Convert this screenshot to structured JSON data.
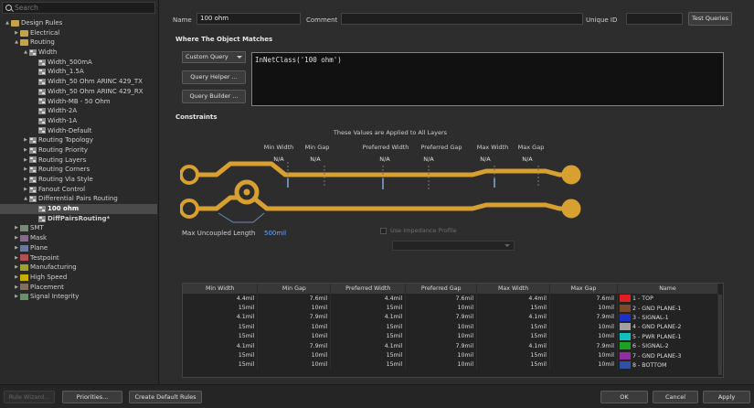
{
  "search": {
    "placeholder": "Search"
  },
  "tree": [
    {
      "label": "Design Rules",
      "indent": 0,
      "tw": "▲",
      "icon": "folder"
    },
    {
      "label": "Electrical",
      "indent": 1,
      "tw": "▶",
      "icon": "folder"
    },
    {
      "label": "Routing",
      "indent": 1,
      "tw": "▲",
      "icon": "folder"
    },
    {
      "label": "Width",
      "indent": 2,
      "tw": "▲",
      "icon": "rule"
    },
    {
      "label": "Width_500mA",
      "indent": 3,
      "tw": "",
      "icon": "rule"
    },
    {
      "label": "Width_1.5A",
      "indent": 3,
      "tw": "",
      "icon": "rule"
    },
    {
      "label": "Width_50 Ohm ARINC 429_TX",
      "indent": 3,
      "tw": "",
      "icon": "rule"
    },
    {
      "label": "Width_50 Ohm ARINC 429_RX",
      "indent": 3,
      "tw": "",
      "icon": "rule"
    },
    {
      "label": "Width-MB - 50 Ohm",
      "indent": 3,
      "tw": "",
      "icon": "rule"
    },
    {
      "label": "Width-2A",
      "indent": 3,
      "tw": "",
      "icon": "rule"
    },
    {
      "label": "Width-1A",
      "indent": 3,
      "tw": "",
      "icon": "rule"
    },
    {
      "label": "Width-Default",
      "indent": 3,
      "tw": "",
      "icon": "rule"
    },
    {
      "label": "Routing Topology",
      "indent": 2,
      "tw": "▶",
      "icon": "rule"
    },
    {
      "label": "Routing Priority",
      "indent": 2,
      "tw": "▶",
      "icon": "rule"
    },
    {
      "label": "Routing Layers",
      "indent": 2,
      "tw": "▶",
      "icon": "rule"
    },
    {
      "label": "Routing Corners",
      "indent": 2,
      "tw": "▶",
      "icon": "rule"
    },
    {
      "label": "Routing Via Style",
      "indent": 2,
      "tw": "▶",
      "icon": "rule"
    },
    {
      "label": "Fanout Control",
      "indent": 2,
      "tw": "▶",
      "icon": "rule"
    },
    {
      "label": "Differential Pairs Routing",
      "indent": 2,
      "tw": "▲",
      "icon": "rule"
    },
    {
      "label": "100 ohm",
      "indent": 3,
      "tw": "",
      "icon": "rule",
      "selected": true
    },
    {
      "label": "DiffPairsRouting*",
      "indent": 3,
      "tw": "",
      "icon": "rule",
      "bold": true
    },
    {
      "label": "SMT",
      "indent": 1,
      "tw": "▶",
      "icon": "c-smt"
    },
    {
      "label": "Mask",
      "indent": 1,
      "tw": "▶",
      "icon": "c-mask"
    },
    {
      "label": "Plane",
      "indent": 1,
      "tw": "▶",
      "icon": "c-plane"
    },
    {
      "label": "Testpoint",
      "indent": 1,
      "tw": "▶",
      "icon": "c-test"
    },
    {
      "label": "Manufacturing",
      "indent": 1,
      "tw": "▶",
      "icon": "c-manu"
    },
    {
      "label": "High Speed",
      "indent": 1,
      "tw": "▶",
      "icon": "c-high"
    },
    {
      "label": "Placement",
      "indent": 1,
      "tw": "▶",
      "icon": "c-place"
    },
    {
      "label": "Signal Integrity",
      "indent": 1,
      "tw": "▶",
      "icon": "c-sig"
    }
  ],
  "rule": {
    "name_label": "Name",
    "name_value": "100 ohm",
    "comment_label": "Comment",
    "comment_value": "",
    "uid_label": "Unique ID",
    "uid_value": "",
    "test_queries": "Test Queries"
  },
  "match": {
    "title": "Where The Object Matches",
    "mode": "Custom Query",
    "query_helper": "Query Helper ...",
    "query_builder": "Query Builder ...",
    "query_text": "InNetClass('100 ohm')"
  },
  "constraints": {
    "title": "Constraints",
    "applied_note": "These Values are Applied to All Layers",
    "captions": [
      {
        "label": "Min Width",
        "value": "N/A"
      },
      {
        "label": "Min Gap",
        "value": "N/A"
      },
      {
        "label": "Preferred Width",
        "value": "N/A"
      },
      {
        "label": "Preferred Gap",
        "value": "N/A"
      },
      {
        "label": "Max Width",
        "value": "N/A"
      },
      {
        "label": "Max Gap",
        "value": "N/A"
      }
    ],
    "max_uncoupled_label": "Max Uncoupled Length",
    "max_uncoupled_value": "500mil",
    "impedance_label": "Use Impedance Profile"
  },
  "table": {
    "headers": [
      "Min Width",
      "Min Gap",
      "Preferred Width",
      "Preferred Gap",
      "Max Width",
      "Max Gap",
      "Name"
    ],
    "rows": [
      {
        "cells": [
          "4.4mil",
          "7.6mil",
          "4.4mil",
          "7.6mil",
          "4.4mil",
          "7.6mil"
        ],
        "name": "1 - TOP",
        "color": "#e02020"
      },
      {
        "cells": [
          "15mil",
          "10mil",
          "15mil",
          "10mil",
          "15mil",
          "10mil"
        ],
        "name": "2 - GND PLANE-1",
        "color": "#7a4a2a"
      },
      {
        "cells": [
          "4.1mil",
          "7.9mil",
          "4.1mil",
          "7.9mil",
          "4.1mil",
          "7.9mil"
        ],
        "name": "3 - SIGNAL-1",
        "color": "#2030c0"
      },
      {
        "cells": [
          "15mil",
          "10mil",
          "15mil",
          "10mil",
          "15mil",
          "10mil"
        ],
        "name": "4 - GND PLANE-2",
        "color": "#a0a0a0"
      },
      {
        "cells": [
          "15mil",
          "10mil",
          "15mil",
          "10mil",
          "15mil",
          "10mil"
        ],
        "name": "5 - PWR PLANE-1",
        "color": "#10c0c0"
      },
      {
        "cells": [
          "4.1mil",
          "7.9mil",
          "4.1mil",
          "7.9mil",
          "4.1mil",
          "7.9mil"
        ],
        "name": "6 - SIGNAL-2",
        "color": "#20a020"
      },
      {
        "cells": [
          "15mil",
          "10mil",
          "15mil",
          "10mil",
          "15mil",
          "10mil"
        ],
        "name": "7 - GND PLANE-3",
        "color": "#9030a0"
      },
      {
        "cells": [
          "15mil",
          "10mil",
          "15mil",
          "10mil",
          "15mil",
          "10mil"
        ],
        "name": "8 - BOTTOM",
        "color": "#3050a0"
      }
    ]
  },
  "bottom": {
    "rule_wizard": "Rule Wizard...",
    "priorities": "Priorities...",
    "create_default": "Create Default Rules",
    "ok": "OK",
    "cancel": "Cancel",
    "apply": "Apply"
  }
}
